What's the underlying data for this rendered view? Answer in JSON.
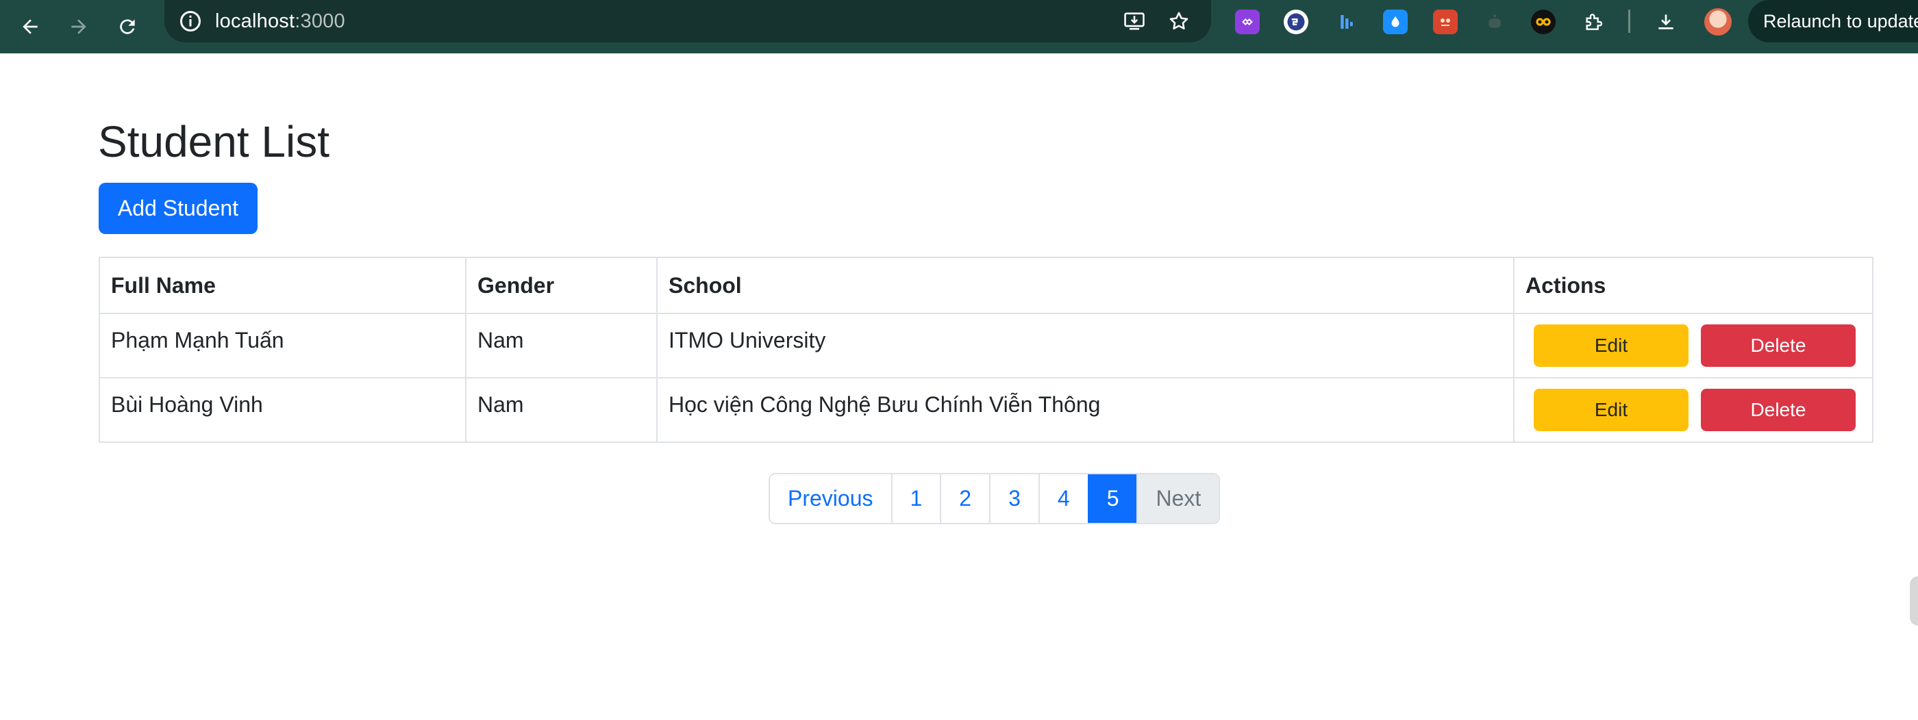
{
  "browser": {
    "url_host": "localhost",
    "url_port": ":3000",
    "relaunch_label": "Relaunch to update"
  },
  "page": {
    "title": "Student List",
    "add_button_label": "Add Student"
  },
  "table": {
    "headers": [
      "Full Name",
      "Gender",
      "School",
      "Actions"
    ],
    "rows": [
      {
        "full_name": "Phạm Mạnh Tuấn",
        "gender": "Nam",
        "school": "ITMO University"
      },
      {
        "full_name": "Bùi Hoàng Vinh",
        "gender": "Nam",
        "school": "Học viện Công Nghệ Bưu Chính Viễn Thông"
      }
    ],
    "edit_label": "Edit",
    "delete_label": "Delete"
  },
  "pagination": {
    "previous_label": "Previous",
    "pages": [
      "1",
      "2",
      "3",
      "4",
      "5"
    ],
    "current_page": "5",
    "next_label": "Next"
  },
  "colors": {
    "primary": "#0d6efd",
    "warning": "#ffc107",
    "danger": "#dc3545",
    "toolbar": "#1f4a43"
  }
}
